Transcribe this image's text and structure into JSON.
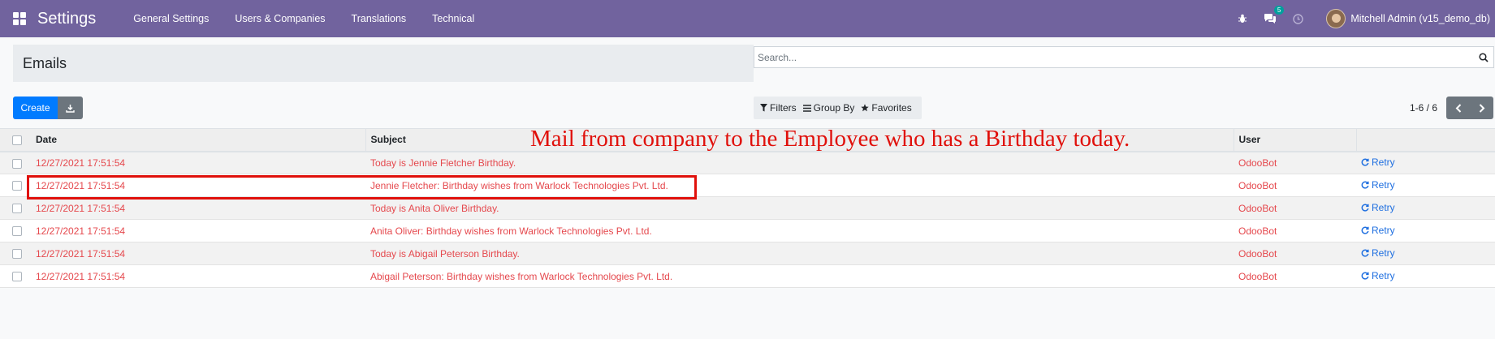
{
  "navbar": {
    "app_title": "Settings",
    "menu": [
      "General Settings",
      "Users & Companies",
      "Translations",
      "Technical"
    ],
    "messages_count": "5",
    "user_name": "Mitchell Admin (v15_demo_db)"
  },
  "control_panel": {
    "breadcrumb_title": "Emails",
    "search_placeholder": "Search...",
    "create_label": "Create",
    "filters_label": "Filters",
    "group_by_label": "Group By",
    "favorites_label": "Favorites",
    "pager_value": "1-6 / 6"
  },
  "table": {
    "headers": {
      "date": "Date",
      "subject": "Subject",
      "user": "User"
    },
    "rows": [
      {
        "date": "12/27/2021 17:51:54",
        "subject": "Today is Jennie Fletcher Birthday.",
        "user": "OdooBot",
        "action": "Retry"
      },
      {
        "date": "12/27/2021 17:51:54",
        "subject": "Jennie Fletcher: Birthday wishes from Warlock Technologies Pvt. Ltd.",
        "user": "OdooBot",
        "action": "Retry"
      },
      {
        "date": "12/27/2021 17:51:54",
        "subject": "Today is Anita Oliver Birthday.",
        "user": "OdooBot",
        "action": "Retry"
      },
      {
        "date": "12/27/2021 17:51:54",
        "subject": "Anita Oliver: Birthday wishes from Warlock Technologies Pvt. Ltd.",
        "user": "OdooBot",
        "action": "Retry"
      },
      {
        "date": "12/27/2021 17:51:54",
        "subject": "Today is Abigail Peterson Birthday.",
        "user": "OdooBot",
        "action": "Retry"
      },
      {
        "date": "12/27/2021 17:51:54",
        "subject": "Abigail Peterson: Birthday wishes from Warlock Technologies Pvt. Ltd.",
        "user": "OdooBot",
        "action": "Retry"
      }
    ]
  },
  "annotation": {
    "text": "Mail from company to the Employee who has a Birthday today."
  },
  "colors": {
    "navbar": "#71639e",
    "primary": "#007bff",
    "failed_row_text": "#e5484d",
    "annotation": "#e0100b"
  }
}
